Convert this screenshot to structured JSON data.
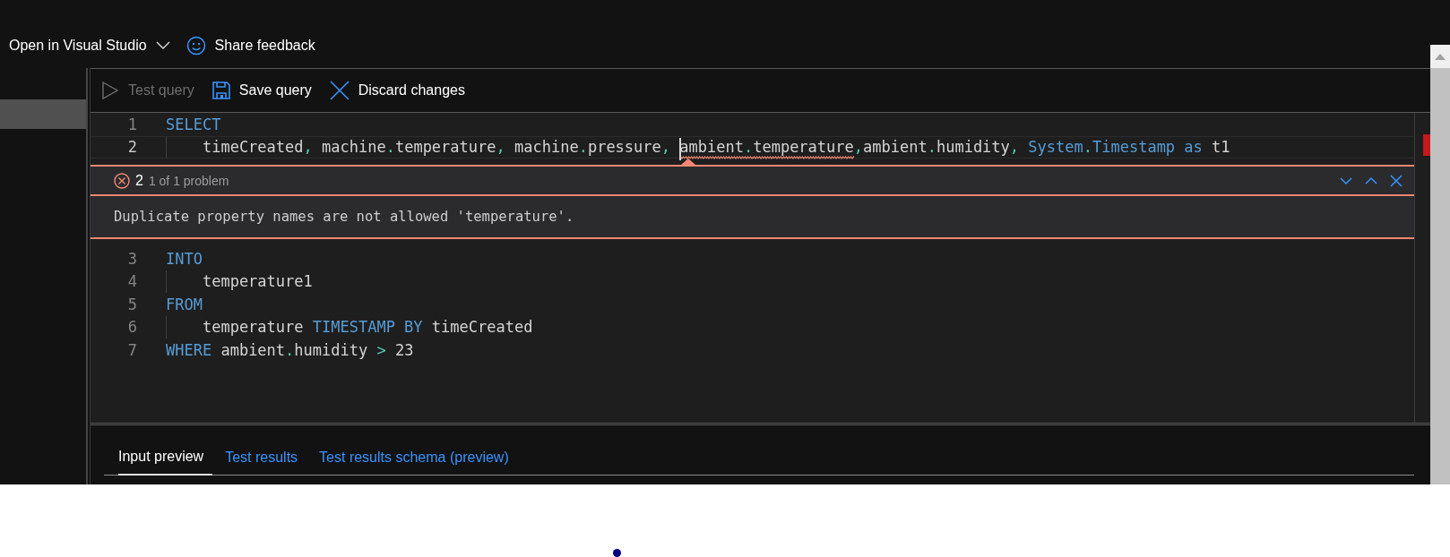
{
  "top_bar": [
    {
      "kind": "dropdown",
      "label": "Open in Visual Studio"
    },
    {
      "kind": "feedback",
      "label": "Share feedback"
    }
  ],
  "query_toolbar": [
    {
      "kind": "run",
      "label": "Test query",
      "disabled": true
    },
    {
      "kind": "save",
      "label": "Save query",
      "disabled": false
    },
    {
      "kind": "discard",
      "label": "Discard changes",
      "disabled": false
    }
  ],
  "editor": {
    "lines": [
      {
        "number": "1",
        "current": false,
        "indented": false,
        "tokens": [
          {
            "kind": "keyword",
            "text": "SELECT"
          }
        ]
      },
      {
        "number": "2",
        "current": true,
        "indented": true,
        "tokens": [
          {
            "kind": "text",
            "text": "timeCreated"
          },
          {
            "kind": "punct",
            "text": ","
          },
          {
            "kind": "text",
            "text": " machine"
          },
          {
            "kind": "punct",
            "text": "."
          },
          {
            "kind": "text",
            "text": "temperature"
          },
          {
            "kind": "punct",
            "text": ","
          },
          {
            "kind": "text",
            "text": " machine"
          },
          {
            "kind": "punct",
            "text": "."
          },
          {
            "kind": "text",
            "text": "pressure"
          },
          {
            "kind": "punct",
            "text": ", "
          },
          {
            "kind": "text",
            "text": "ambient",
            "error": true,
            "cursor": true
          },
          {
            "kind": "punct",
            "text": ".",
            "error": true
          },
          {
            "kind": "text",
            "text": "temperature",
            "error": true
          },
          {
            "kind": "punct",
            "text": ","
          },
          {
            "kind": "text",
            "text": "ambient"
          },
          {
            "kind": "punct",
            "text": "."
          },
          {
            "kind": "text",
            "text": "humidity"
          },
          {
            "kind": "punct",
            "text": ", "
          },
          {
            "kind": "keyword",
            "text": "System"
          },
          {
            "kind": "punct",
            "text": "."
          },
          {
            "kind": "keyword",
            "text": "Timestamp"
          },
          {
            "kind": "keyword",
            "text": " as"
          },
          {
            "kind": "text",
            "text": " t1"
          }
        ],
        "problem": {
          "count": "2",
          "summary": "1 of 1 problem",
          "message": "Duplicate property names are not allowed 'temperature'."
        }
      },
      {
        "number": "3",
        "current": false,
        "indented": false,
        "tokens": [
          {
            "kind": "keyword",
            "text": "INTO"
          }
        ]
      },
      {
        "number": "4",
        "current": false,
        "indented": true,
        "tokens": [
          {
            "kind": "text",
            "text": "temperature1"
          }
        ]
      },
      {
        "number": "5",
        "current": false,
        "indented": false,
        "tokens": [
          {
            "kind": "keyword",
            "text": "FROM"
          }
        ]
      },
      {
        "number": "6",
        "current": false,
        "indented": true,
        "tokens": [
          {
            "kind": "text",
            "text": "temperature"
          },
          {
            "kind": "keyword",
            "text": " TIMESTAMP BY"
          },
          {
            "kind": "text",
            "text": " timeCreated"
          }
        ]
      },
      {
        "number": "7",
        "current": false,
        "indented": false,
        "tokens": [
          {
            "kind": "keyword",
            "text": "WHERE"
          },
          {
            "kind": "text",
            "text": " ambient"
          },
          {
            "kind": "punct",
            "text": "."
          },
          {
            "kind": "text",
            "text": "humidity "
          },
          {
            "kind": "punct",
            "text": ">"
          },
          {
            "kind": "text",
            "text": " 23"
          }
        ]
      }
    ]
  },
  "result_tabs": [
    {
      "label": "Input preview",
      "selected": true
    },
    {
      "label": "Test results",
      "selected": false
    },
    {
      "label": "Test results schema (preview)",
      "selected": false
    }
  ]
}
